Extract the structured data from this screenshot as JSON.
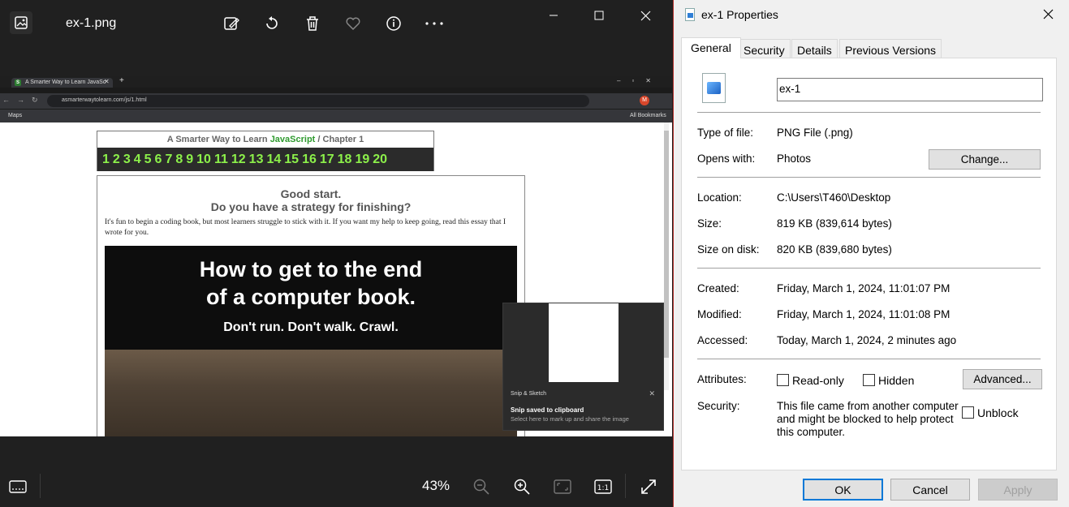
{
  "viewer": {
    "file_name": "ex-1.png",
    "toolbar": [
      "edit-image-icon",
      "rotate-icon",
      "delete-icon",
      "favorite-icon",
      "info-icon",
      "more-icon"
    ],
    "zoom": "43%"
  },
  "browser": {
    "tab_title": "A Smarter Way to Learn JavaSc",
    "url": "asmarterwaytolearn.com/js/1.html",
    "bookmark": "Maps",
    "all_bookmarks": "All Bookmarks",
    "profile_initial": "M"
  },
  "webpage": {
    "header_prefix": "A Smarter Way to Learn ",
    "header_js": "JavaScript",
    "header_suffix": " / Chapter 1",
    "chapters": [
      "1",
      "2",
      "3",
      "4",
      "5",
      "6",
      "7",
      "8",
      "9",
      "10",
      "11",
      "12",
      "13",
      "14",
      "15",
      "16",
      "17",
      "18",
      "19",
      "20"
    ],
    "heading1": "Good start.",
    "heading2": "Do you have a strategy for finishing?",
    "body": "It's fun to begin a coding book, but most learners struggle to stick with it. If you want my help to keep going, read this essay that I wrote for you.",
    "banner_line1": "How to get to the end",
    "banner_line2": "of a computer book.",
    "banner_line3": "Don't run. Don't walk. Crawl."
  },
  "toast": {
    "app": "Snip & Sketch",
    "title": "Snip saved to clipboard",
    "subtitle": "Select here to mark up and share the image"
  },
  "properties": {
    "window_title": "ex-1 Properties",
    "tabs": [
      "General",
      "Security",
      "Details",
      "Previous Versions"
    ],
    "name": "ex-1",
    "labels": {
      "type": "Type of file:",
      "opens": "Opens with:",
      "location": "Location:",
      "size": "Size:",
      "size_on_disk": "Size on disk:",
      "created": "Created:",
      "modified": "Modified:",
      "accessed": "Accessed:",
      "attributes": "Attributes:",
      "security": "Security:"
    },
    "values": {
      "type": "PNG File (.png)",
      "opens": "Photos",
      "location": "C:\\Users\\T460\\Desktop",
      "size": "819 KB (839,614 bytes)",
      "size_on_disk": "820 KB (839,680 bytes)",
      "created": "Friday, March 1, 2024, 11:01:07 PM",
      "modified": "Friday, March 1, 2024, 11:01:08 PM",
      "accessed": "Today, March 1, 2024, 2 minutes ago",
      "security": "This file came from another computer and might be blocked to help protect this computer."
    },
    "buttons": {
      "change": "Change...",
      "advanced": "Advanced...",
      "ok": "OK",
      "cancel": "Cancel",
      "apply": "Apply"
    },
    "checkboxes": {
      "readonly": "Read-only",
      "hidden": "Hidden",
      "unblock": "Unblock"
    }
  }
}
